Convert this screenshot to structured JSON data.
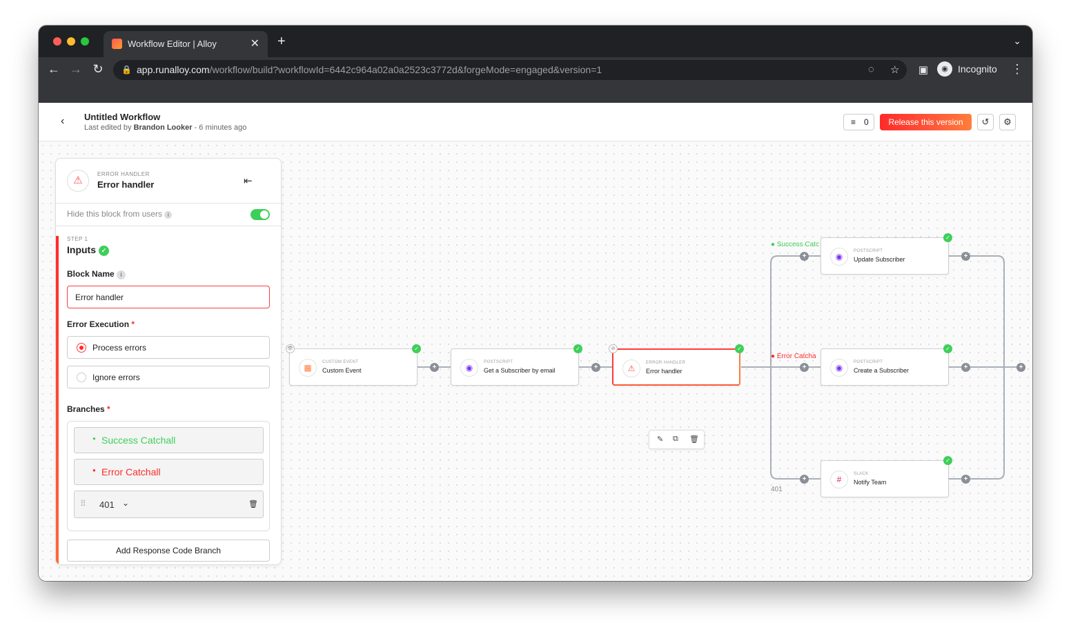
{
  "browser": {
    "tab_title": "Workflow Editor | Alloy",
    "tab_close": "✕",
    "new_tab": "+",
    "url_host": "app.runalloy.com",
    "url_path": "/workflow/build?workflowId=6442c964a02a0a2523c3772d&forgeMode=engaged&version=1",
    "profile_label": "Incognito"
  },
  "header": {
    "title": "Untitled Workflow",
    "edited_prefix": "Last edited by",
    "edited_by": "Brandon Looker",
    "edited_suffix": "- 6 minutes ago",
    "count": "0",
    "release_label": "Release this version"
  },
  "panel": {
    "caption": "ERROR HANDLER",
    "title": "Error handler",
    "hide_label": "Hide this block from users",
    "hide_toggle_on": true,
    "step_caption": "STEP 1",
    "step_title": "Inputs",
    "block_name_label": "Block Name",
    "block_name_value": "Error handler",
    "error_exec_label": "Error Execution",
    "required_mark": "*",
    "options": [
      {
        "label": "Process errors",
        "selected": true
      },
      {
        "label": "Ignore errors",
        "selected": false
      }
    ],
    "branches_label": "Branches",
    "branches": [
      {
        "label": "Success Catchall",
        "color": "#3ecf5a"
      },
      {
        "label": "Error Catchall",
        "color": "#ff2a2a"
      }
    ],
    "response_code": "401",
    "add_branch_label": "Add Response Code Branch"
  },
  "nodes": [
    {
      "caption": "CUSTOM EVENT",
      "name": "Custom Event"
    },
    {
      "caption": "POSTSCRIPT",
      "name": "Get a Subscriber by email"
    },
    {
      "caption": "ERROR HANDLER",
      "name": "Error handler"
    },
    {
      "caption": "POSTSCRIPT",
      "name": "Update Subscriber"
    },
    {
      "caption": "POSTSCRIPT",
      "name": "Create a Subscriber"
    },
    {
      "caption": "SLACK",
      "name": "Notify Team"
    }
  ],
  "branch_labels": {
    "success": "Success Catc",
    "error": "Error Catcha",
    "code": "401"
  },
  "colors": {
    "accent_red": "#ff2a2a",
    "success_green": "#3ecf5a",
    "postscript_purple": "#7b2ff7"
  }
}
